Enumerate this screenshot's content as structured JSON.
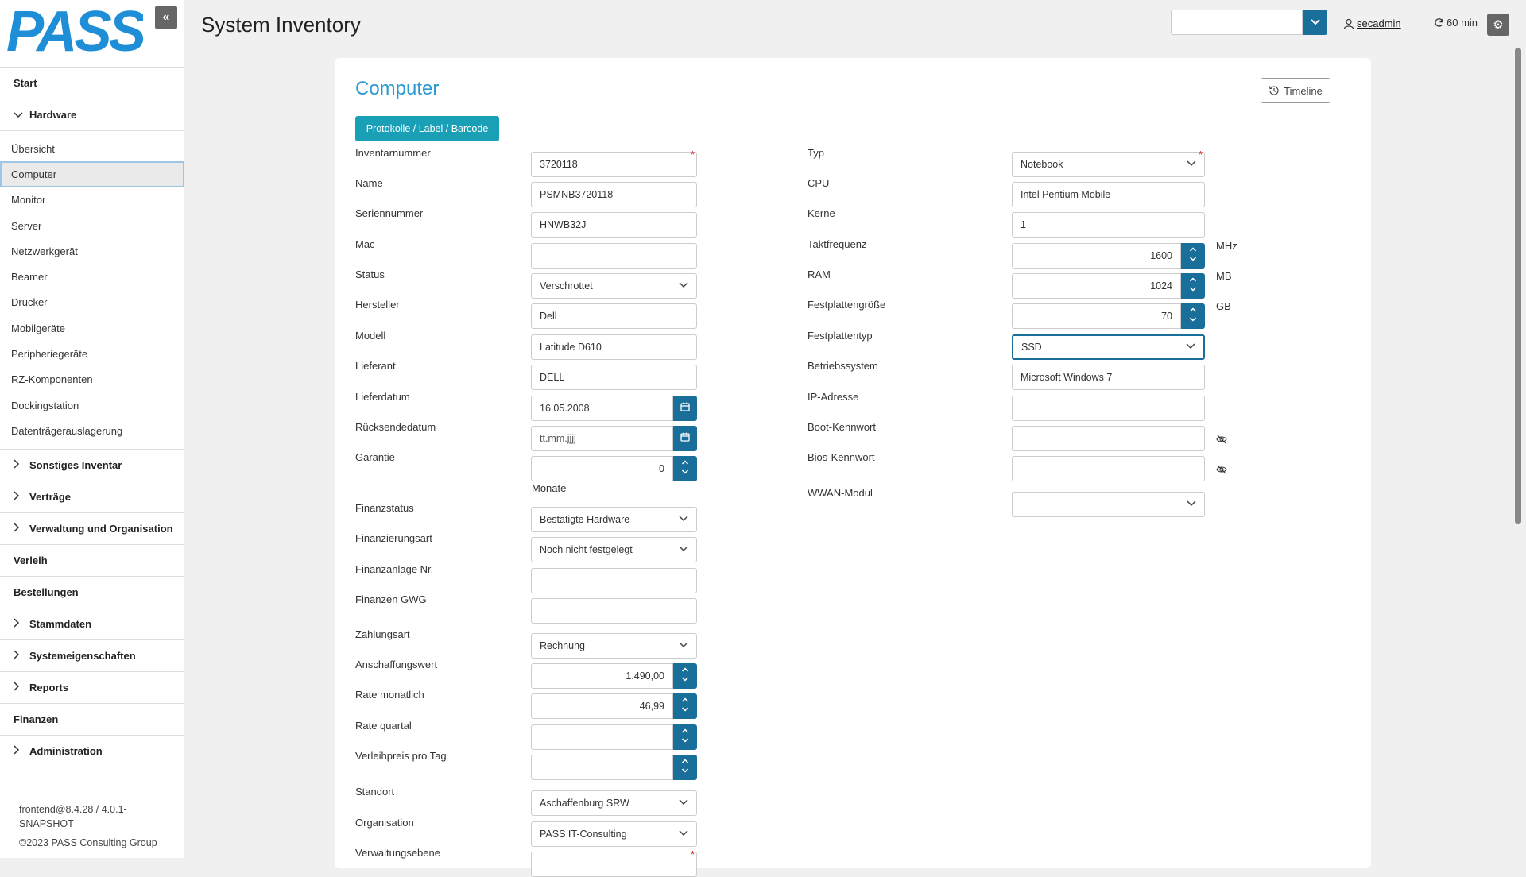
{
  "app": {
    "title": "System Inventory",
    "logo_text": "PASS"
  },
  "header": {
    "user": "secadmin",
    "timer": "60 min",
    "select_value": ""
  },
  "sidebar": {
    "start": "Start",
    "hardware": "Hardware",
    "hardware_items": [
      "Übersicht",
      "Computer",
      "Monitor",
      "Server",
      "Netzwerkgerät",
      "Beamer",
      "Drucker",
      "Mobilgeräte",
      "Peripheriegeräte",
      "RZ-Komponenten",
      "Dockingstation",
      "Datenträgerauslagerung"
    ],
    "groups": [
      {
        "label": "Sonstiges Inventar",
        "chevron": true
      },
      {
        "label": "Verträge",
        "chevron": true
      },
      {
        "label": "Verwaltung und Organisation",
        "chevron": true
      },
      {
        "label": "Verleih",
        "chevron": false
      },
      {
        "label": "Bestellungen",
        "chevron": false
      },
      {
        "label": "Stammdaten",
        "chevron": true
      },
      {
        "label": "Systemeigenschaften",
        "chevron": true
      },
      {
        "label": "Reports",
        "chevron": true
      },
      {
        "label": "Finanzen",
        "chevron": false
      },
      {
        "label": "Administration",
        "chevron": true
      }
    ],
    "footer_version": "frontend@8.4.28 / 4.0.1-SNAPSHOT",
    "footer_copyright": "©2023 PASS Consulting Group"
  },
  "card": {
    "title": "Computer",
    "timeline": "Timeline",
    "protocol_button": "Protokolle / Label / Barcode",
    "left": {
      "inventarnummer": {
        "label": "Inventarnummer",
        "value": "3720118"
      },
      "name": {
        "label": "Name",
        "value": "PSMNB3720118"
      },
      "seriennummer": {
        "label": "Seriennummer",
        "value": "HNWB32J"
      },
      "mac": {
        "label": "Mac",
        "value": ""
      },
      "status": {
        "label": "Status",
        "value": "Verschrottet"
      },
      "hersteller": {
        "label": "Hersteller",
        "value": "Dell"
      },
      "modell": {
        "label": "Modell",
        "value": "Latitude D610"
      },
      "lieferant": {
        "label": "Lieferant",
        "value": "DELL"
      },
      "lieferdatum": {
        "label": "Lieferdatum",
        "value": "16.05.2008"
      },
      "ruecksendedatum": {
        "label": "Rücksendedatum",
        "placeholder": "tt.mm.jjjj"
      },
      "garantie": {
        "label": "Garantie",
        "value": "0",
        "unit": "Monate"
      },
      "finanzstatus": {
        "label": "Finanzstatus",
        "value": "Bestätigte Hardware"
      },
      "finanzierungsart": {
        "label": "Finanzierungsart",
        "value": "Noch nicht festgelegt"
      },
      "finanzanlage": {
        "label": "Finanzanlage Nr.",
        "value": ""
      },
      "finanzen_gwg": {
        "label": "Finanzen GWG",
        "value": ""
      },
      "zahlungsart": {
        "label": "Zahlungsart",
        "value": "Rechnung"
      },
      "anschaffungswert": {
        "label": "Anschaffungswert",
        "value": "1.490,00"
      },
      "rate_monatlich": {
        "label": "Rate monatlich",
        "value": "46,99"
      },
      "rate_quartal": {
        "label": "Rate quartal",
        "value": ""
      },
      "verleihpreis": {
        "label": "Verleihpreis pro Tag",
        "value": ""
      },
      "standort": {
        "label": "Standort",
        "value": "Aschaffenburg SRW"
      },
      "organisation": {
        "label": "Organisation",
        "value": "PASS IT-Consulting"
      },
      "verwaltungsebene": {
        "label": "Verwaltungsebene",
        "value": ""
      }
    },
    "right": {
      "typ": {
        "label": "Typ",
        "value": "Notebook"
      },
      "cpu": {
        "label": "CPU",
        "value": "Intel Pentium Mobile"
      },
      "kerne": {
        "label": "Kerne",
        "value": "1"
      },
      "taktfrequenz": {
        "label": "Taktfrequenz",
        "value": "1600",
        "unit": "MHz"
      },
      "ram": {
        "label": "RAM",
        "value": "1024",
        "unit": "MB"
      },
      "festplattengroesse": {
        "label": "Festplattengröße",
        "value": "70",
        "unit": "GB"
      },
      "festplattentyp": {
        "label": "Festplattentyp",
        "value": "SSD"
      },
      "betriebssystem": {
        "label": "Betriebssystem",
        "value": "Microsoft Windows 7"
      },
      "ip_adresse": {
        "label": "IP-Adresse",
        "value": ""
      },
      "boot_kennwort": {
        "label": "Boot-Kennwort",
        "value": ""
      },
      "bios_kennwort": {
        "label": "Bios-Kennwort",
        "value": ""
      },
      "wwan_modul": {
        "label": "WWAN-Modul",
        "value": ""
      }
    }
  },
  "icons": [
    "collapse-icon",
    "chevron-down-icon",
    "user-icon",
    "refresh-icon",
    "gear-icon",
    "history-icon",
    "calendar-icon",
    "spinner-icon",
    "eye-off-icon",
    "chevron-right-icon"
  ],
  "colors": {
    "accent": "#1a6e9a",
    "title": "#2a9ad4",
    "proto": "#1aa0b6",
    "logo": "#1e8fd6",
    "required": "#e02020"
  }
}
